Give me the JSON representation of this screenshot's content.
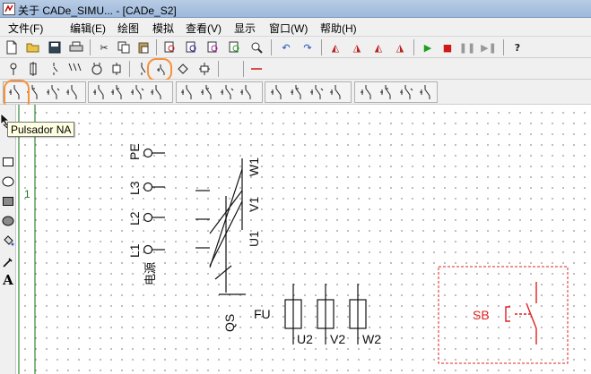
{
  "window": {
    "title": "关于 CADe_SIMU... - [CADe_S2]"
  },
  "menu": [
    "文件(F)",
    "编辑(E)",
    "绘图",
    "模拟",
    "查看(V)",
    "显示",
    "窗口(W)",
    "帮助(H)"
  ],
  "tooltip": {
    "text": "Pulsador NA"
  },
  "canvas": {
    "row_marker": "1",
    "supply_labels": {
      "pe": "PE",
      "l3": "L3",
      "l2": "L2",
      "l1": "L1",
      "source": "电源"
    },
    "switch_labels": {
      "w1": "W1",
      "v1": "V1",
      "u1": "U1",
      "qs": "QS"
    },
    "fuse_labels": {
      "fu": "FU",
      "u2": "U2",
      "v2": "V2",
      "w2": "W2"
    },
    "pushbutton_label": "SB"
  },
  "colors": {
    "accent_annotation": "#f5923e",
    "selection_red": "#e02020",
    "grid_rule": "#2e8b2e"
  }
}
